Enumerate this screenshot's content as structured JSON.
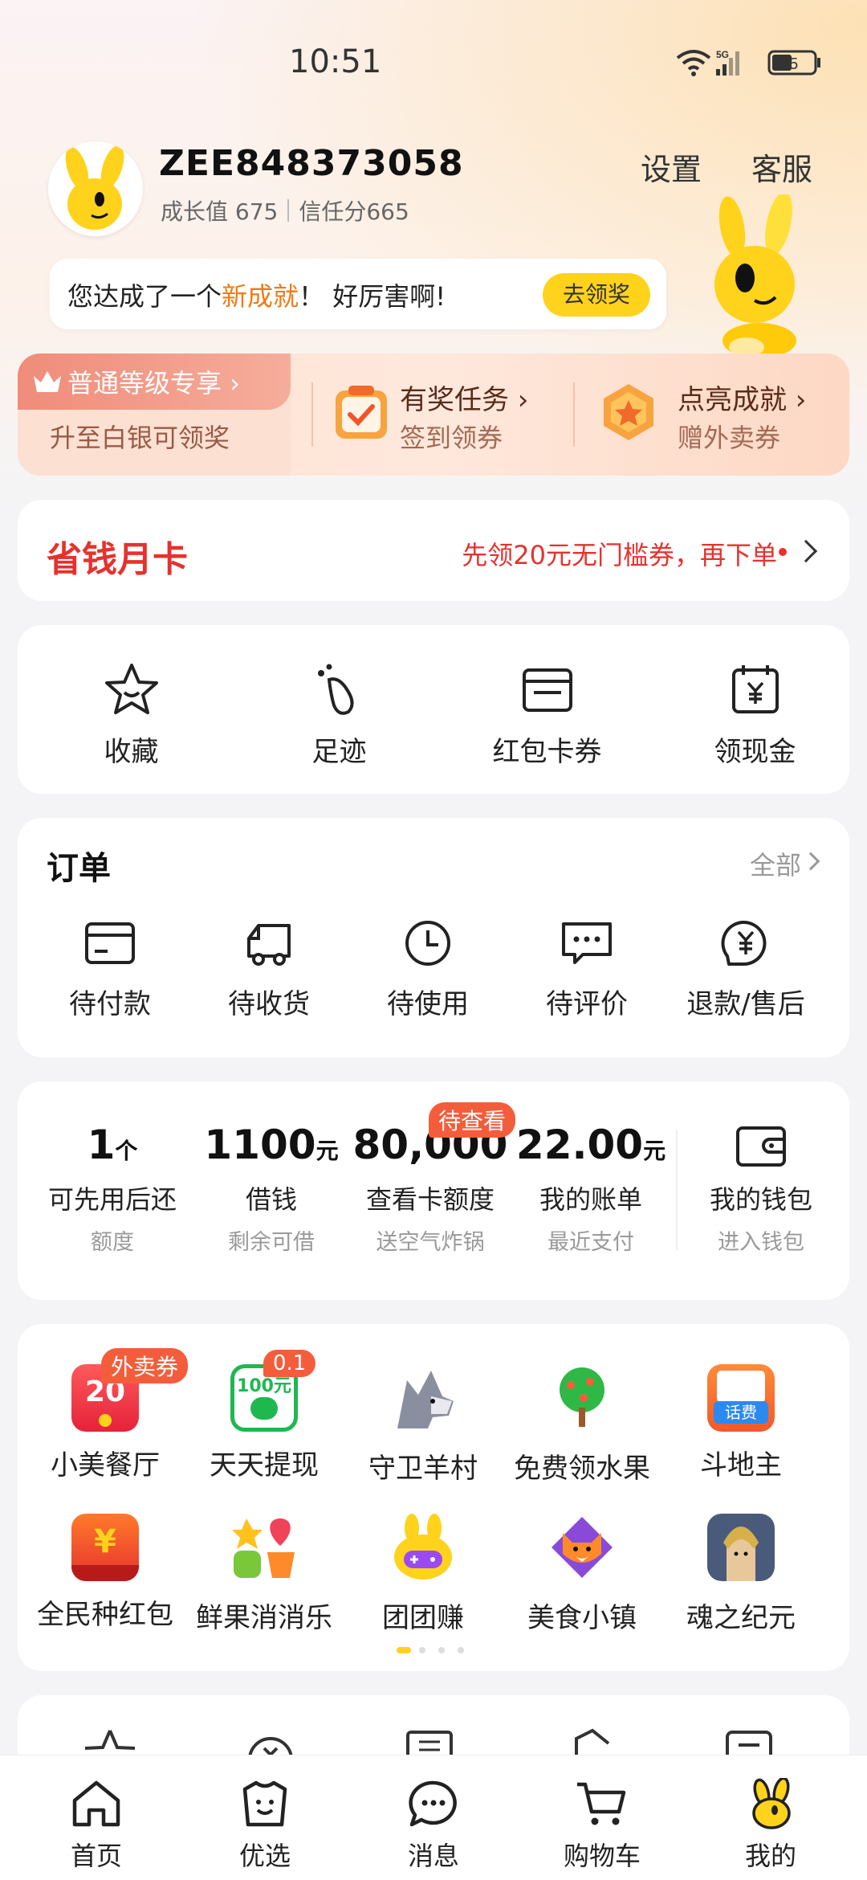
{
  "status": {
    "time": "10:51",
    "battery": "45",
    "network": "5G"
  },
  "profile": {
    "username": "ZEE848373058",
    "growth": "成长值 675",
    "trust": "信任分665",
    "settings": "设置",
    "service": "客服"
  },
  "achievement": {
    "text_a": "您达成了一个",
    "text_hl": "新成就",
    "text_b": "！ 好厉害啊!",
    "button": "去领奖"
  },
  "tier": {
    "tag": "普通等级专享",
    "sub": "升至白银可领奖",
    "task_title": "有奖任务",
    "task_sub": "签到领券",
    "ach_title": "点亮成就",
    "ach_sub": "赠外卖券"
  },
  "savings": {
    "title": "省钱月卡",
    "promo": "先领20元无门槛券，再下单"
  },
  "quick_actions": [
    {
      "label": "收藏",
      "icon": "star-icon"
    },
    {
      "label": "足迹",
      "icon": "footprint-icon"
    },
    {
      "label": "红包卡券",
      "icon": "wallet-card-icon"
    },
    {
      "label": "领现金",
      "icon": "calendar-yen-icon"
    }
  ],
  "orders": {
    "title": "订单",
    "all": "全部",
    "items": [
      {
        "label": "待付款",
        "icon": "card-icon"
      },
      {
        "label": "待收货",
        "icon": "truck-icon"
      },
      {
        "label": "待使用",
        "icon": "clock-icon"
      },
      {
        "label": "待评价",
        "icon": "comment-icon"
      },
      {
        "label": "退款/售后",
        "icon": "refund-icon"
      }
    ]
  },
  "finance": {
    "items": [
      {
        "value": "1",
        "unit": "个",
        "label": "可先用后还",
        "sub": "额度"
      },
      {
        "value": "1100",
        "unit": "元",
        "label": "借钱",
        "sub": "剩余可借"
      },
      {
        "value": "80,000",
        "unit": "",
        "label": "查看卡额度",
        "sub": "送空气炸锅",
        "badge": "待查看"
      },
      {
        "value": "22.00",
        "unit": "元",
        "label": "我的账单",
        "sub": "最近支付"
      }
    ],
    "wallet": {
      "label": "我的钱包",
      "sub": "进入钱包"
    }
  },
  "services": {
    "row1": [
      {
        "label": "小美餐厅",
        "badge": "外卖券",
        "icon_text": "20",
        "color": "#f0304a"
      },
      {
        "label": "天天提现",
        "badge": "0.1",
        "icon_text": "100元",
        "color": "#1fb84f"
      },
      {
        "label": "守卫羊村",
        "color": "#8a8fa0"
      },
      {
        "label": "免费领水果",
        "color": "#2fb845"
      },
      {
        "label": "斗地主",
        "icon_text": "话费",
        "color": "#f06a2a"
      }
    ],
    "row2": [
      {
        "label": "全民种红包",
        "icon_text": "¥",
        "color": "#f04a1e"
      },
      {
        "label": "鲜果消消乐",
        "color": "#f7a21c"
      },
      {
        "label": "团团赚",
        "color": "#ffd21c"
      },
      {
        "label": "美食小镇",
        "color": "#f07a2a"
      },
      {
        "label": "魂之纪元",
        "color": "#6a7fa8"
      }
    ]
  },
  "bottom_nav": [
    {
      "label": "首页",
      "icon": "home-icon"
    },
    {
      "label": "优选",
      "icon": "bag-icon"
    },
    {
      "label": "消息",
      "icon": "message-icon"
    },
    {
      "label": "购物车",
      "icon": "cart-icon"
    },
    {
      "label": "我的",
      "icon": "mascot-icon"
    }
  ]
}
